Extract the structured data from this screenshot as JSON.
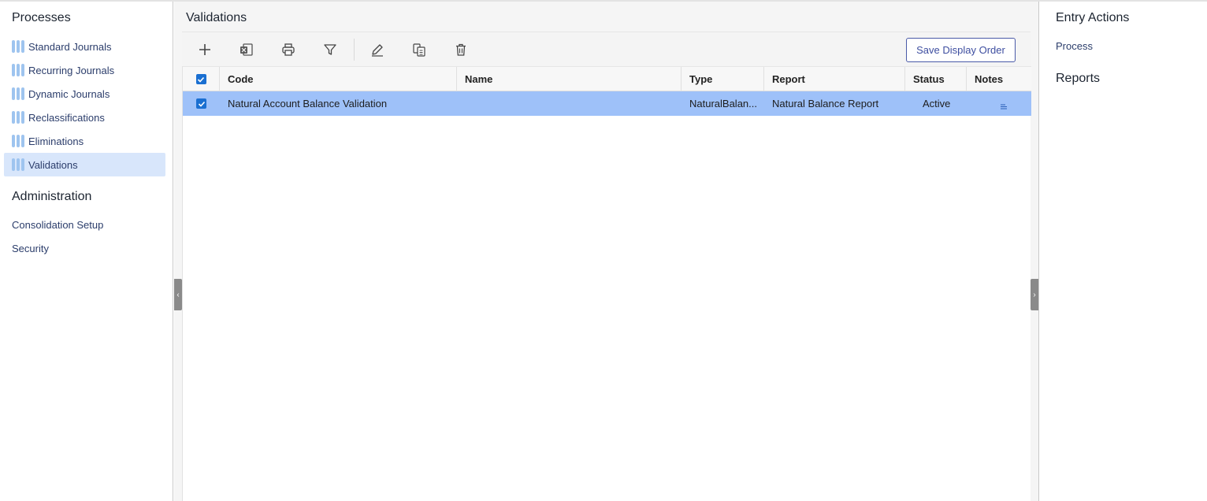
{
  "sidebar": {
    "processes_heading": "Processes",
    "items": [
      {
        "label": "Standard Journals"
      },
      {
        "label": "Recurring Journals"
      },
      {
        "label": "Dynamic Journals"
      },
      {
        "label": "Reclassifications"
      },
      {
        "label": "Eliminations"
      },
      {
        "label": "Validations"
      }
    ],
    "admin_heading": "Administration",
    "admin_items": [
      {
        "label": "Consolidation Setup"
      },
      {
        "label": "Security"
      }
    ]
  },
  "main": {
    "title": "Validations",
    "toolbar": {
      "icons": [
        "add-icon",
        "excel-export-icon",
        "print-icon",
        "filter-icon",
        "edit-icon",
        "copy-icon",
        "delete-icon"
      ],
      "save_label": "Save Display Order"
    },
    "grid": {
      "columns": [
        "Code",
        "Name",
        "Type",
        "Report",
        "Status",
        "Notes"
      ],
      "rows": [
        {
          "selected": true,
          "code": "Natural Account Balance Validation",
          "name": "",
          "type": "NaturalBalan...",
          "report": "Natural Balance Report",
          "status": "Active",
          "notes_icon": "notes-icon"
        }
      ]
    }
  },
  "right_panel": {
    "entry_actions_heading": "Entry Actions",
    "entry_actions": [
      {
        "label": "Process"
      }
    ],
    "reports_heading": "Reports"
  },
  "colors": {
    "accent": "#3e4ea0",
    "selected_row": "#9ec1f9",
    "active_nav": "#d8e6fb",
    "checkbox": "#1a6fd1"
  }
}
